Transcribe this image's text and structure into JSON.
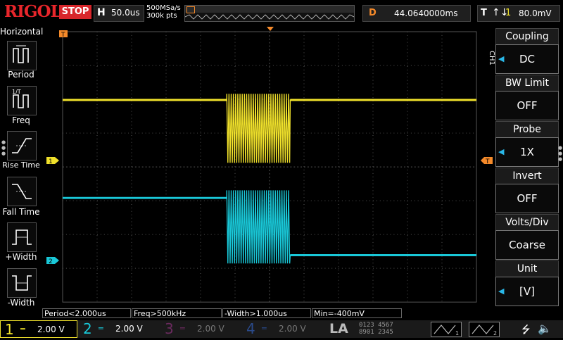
{
  "brand": {
    "logo": "RIGOL"
  },
  "top": {
    "run_state": "STOP",
    "timebase_label": "H",
    "timebase_value": "50.0us",
    "sample_rate": "500MSa/s",
    "memory_depth": "300k pts",
    "delay_label": "D",
    "delay_value": "44.0640000ms",
    "trigger_label": "T",
    "trigger_source": "1",
    "trigger_level": "80.0mV"
  },
  "horizontal_menu": {
    "title": "Horizontal",
    "items": [
      {
        "label": "Period",
        "icon": "period-icon"
      },
      {
        "label": "Freq",
        "icon": "freq-icon"
      },
      {
        "label": "Rise Time",
        "icon": "rise-time-icon"
      },
      {
        "label": "Fall Time",
        "icon": "fall-time-icon"
      },
      {
        "label": "+Width",
        "icon": "positive-width-icon"
      },
      {
        "label": "-Width",
        "icon": "negative-width-icon"
      }
    ]
  },
  "channel_menu": {
    "channel_tab": "CH1",
    "items": [
      {
        "title": "Coupling",
        "value": "DC"
      },
      {
        "title": "BW Limit",
        "value": "OFF"
      },
      {
        "title": "Probe",
        "value": "1X"
      },
      {
        "title": "Invert",
        "value": "OFF"
      },
      {
        "title": "Volts/Div",
        "value": "Coarse"
      },
      {
        "title": "Unit",
        "value": "[V]"
      }
    ]
  },
  "measurements": [
    {
      "text": "Period<2.000us"
    },
    {
      "text": "Freq>500kHz"
    },
    {
      "text": "-Width>1.000us"
    },
    {
      "text": "Min=-400mV"
    }
  ],
  "channels": [
    {
      "number": "1",
      "scale": "2.00 V",
      "color": "#f0e12b",
      "active": true
    },
    {
      "number": "2",
      "scale": "2.00 V",
      "color": "#19c8d8",
      "active": false
    },
    {
      "number": "3",
      "scale": "2.00 V",
      "color": "#c52aa8",
      "active": false
    },
    {
      "number": "4",
      "scale": "2.00 V",
      "color": "#2a6ad8",
      "active": false
    }
  ],
  "logic_analyzer": {
    "label": "LA",
    "row1": "0123 4567",
    "row2": "8901 2345"
  },
  "markers": {
    "ch1_marker": "1",
    "ch2_marker": "2",
    "trigger_marker": "T"
  },
  "colors": {
    "ch1": "#f0e12b",
    "ch2": "#19c8d8",
    "accent": "#f58a2a",
    "stop": "#d8262b",
    "grid": "#555"
  }
}
